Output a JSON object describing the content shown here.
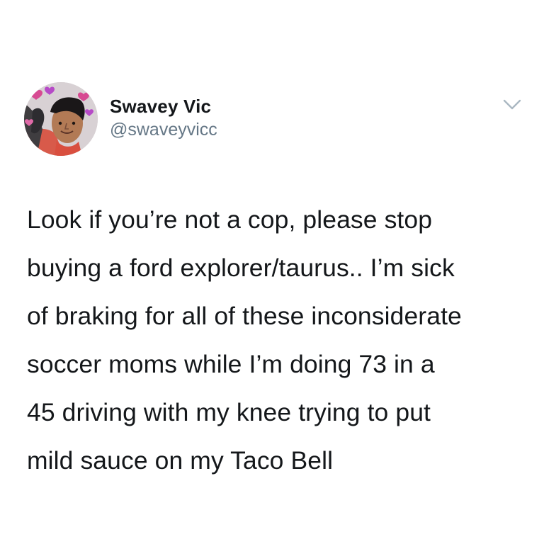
{
  "author": {
    "display_name": "Swavey Vic",
    "handle": "@swaveyvicc",
    "avatar": "profile-photo-with-heart-filter"
  },
  "menu": {
    "icon": "chevron-down-icon"
  },
  "tweet": {
    "lines": [
      "Look if you’re not a cop, please stop",
      "buying a ford explorer/taurus.. I’m sick",
      "of braking for all of these inconsiderate",
      "soccer moms while I’m doing 73 in a",
      "45 driving with my knee trying to put",
      "mild sauce on my Taco Bell"
    ]
  },
  "colors": {
    "text": "#14171a",
    "secondary_text": "#657786",
    "chevron": "#aab8c2",
    "background": "#ffffff"
  }
}
